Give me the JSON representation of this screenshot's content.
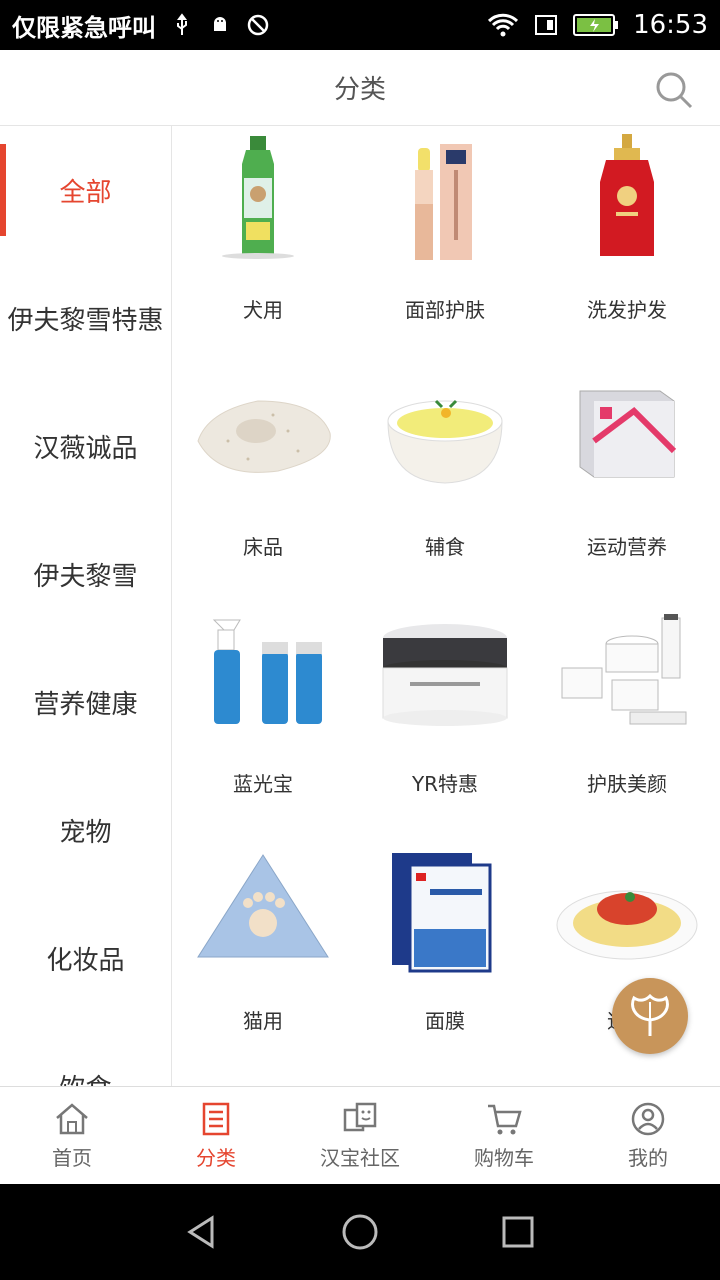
{
  "status_bar": {
    "carrier": "仅限紧急呼叫",
    "time": "16:53"
  },
  "header": {
    "title": "分类"
  },
  "sidebar": {
    "items": [
      {
        "label": "全部",
        "active": true
      },
      {
        "label": "伊夫黎雪特惠"
      },
      {
        "label": "汉薇诚品"
      },
      {
        "label": "伊夫黎雪"
      },
      {
        "label": "营养健康"
      },
      {
        "label": "宠物"
      },
      {
        "label": "化妆品"
      },
      {
        "label": "饮食"
      }
    ]
  },
  "categories": [
    {
      "label": "犬用",
      "icon": "dog-product-bottle-icon"
    },
    {
      "label": "面部护肤",
      "icon": "lip-balm-icon"
    },
    {
      "label": "洗发护发",
      "icon": "shampoo-bottle-icon"
    },
    {
      "label": "床品",
      "icon": "pillow-icon"
    },
    {
      "label": "辅食",
      "icon": "soup-bowl-icon"
    },
    {
      "label": "运动营养",
      "icon": "supplement-box-icon"
    },
    {
      "label": "蓝光宝",
      "icon": "spray-bottles-icon"
    },
    {
      "label": "YR特惠",
      "icon": "cream-jar-icon"
    },
    {
      "label": "护肤美颜",
      "icon": "skincare-set-icon"
    },
    {
      "label": "猫用",
      "icon": "cat-litter-icon"
    },
    {
      "label": "面膜",
      "icon": "face-mask-pack-icon"
    },
    {
      "label": "速食",
      "icon": "pasta-plate-icon"
    }
  ],
  "tabbar": {
    "items": [
      {
        "label": "首页",
        "icon": "home-icon"
      },
      {
        "label": "分类",
        "icon": "category-list-icon",
        "active": true
      },
      {
        "label": "汉宝社区",
        "icon": "community-icon"
      },
      {
        "label": "购物车",
        "icon": "cart-icon"
      },
      {
        "label": "我的",
        "icon": "profile-icon"
      }
    ]
  },
  "colors": {
    "accent": "#e5452f",
    "fab": "#c8955a"
  }
}
